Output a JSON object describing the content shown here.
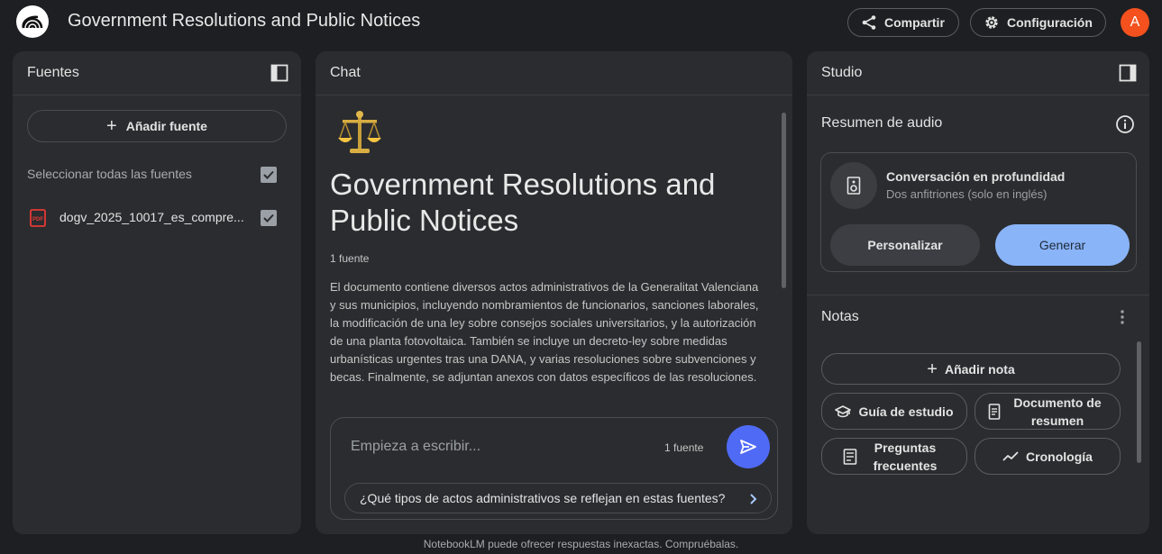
{
  "header": {
    "title": "Government Resolutions and Public Notices",
    "share_label": "Compartir",
    "config_label": "Configuración",
    "avatar_letter": "A",
    "avatar_color": "#f4511e"
  },
  "sources": {
    "title": "Fuentes",
    "add_label": "Añadir fuente",
    "select_all_label": "Seleccionar todas las fuentes",
    "items": [
      {
        "name": "dogv_2025_10017_es_compre...",
        "icon": "pdf-icon",
        "checked": true
      }
    ]
  },
  "chat": {
    "title": "Chat",
    "notebook_title": "Government Resolutions and Public Notices",
    "emoji": "balance-scale-icon",
    "source_count": "1 fuente",
    "summary": "El documento contiene diversos actos administrativos de la Generalitat Valenciana y sus municipios, incluyendo nombramientos de funcionarios, sanciones laborales, la modificación de una ley sobre consejos sociales universitarios, y la autorización de una planta fotovoltaica. También se incluye un decreto-ley sobre medidas urbanísticas urgentes tras una DANA, y varias resoluciones sobre subvenciones y becas. Finalmente, se adjuntan anexos con datos específicos de las resoluciones.",
    "input_placeholder": "Empieza a escribir...",
    "input_source_count": "1 fuente",
    "suggestion": "¿Qué tipos de actos administrativos se reflejan en estas fuentes?",
    "send_color": "#4f6af5"
  },
  "studio": {
    "title": "Studio",
    "audio_title": "Resumen de audio",
    "audio_card_title": "Conversación en profundidad",
    "audio_card_sub": "Dos anfitriones (solo en inglés)",
    "personalize_label": "Personalizar",
    "generate_label": "Generar",
    "generate_color": "#8ab4f8",
    "notes_title": "Notas",
    "add_note_label": "Añadir nota",
    "study_guide_label": "Guía de estudio",
    "summary_doc_label": "Documento de resumen",
    "faq_label": "Preguntas frecuentes",
    "timeline_label": "Cronología"
  },
  "footer": {
    "disclaimer": "NotebookLM puede ofrecer respuestas inexactas. Compruébalas."
  }
}
